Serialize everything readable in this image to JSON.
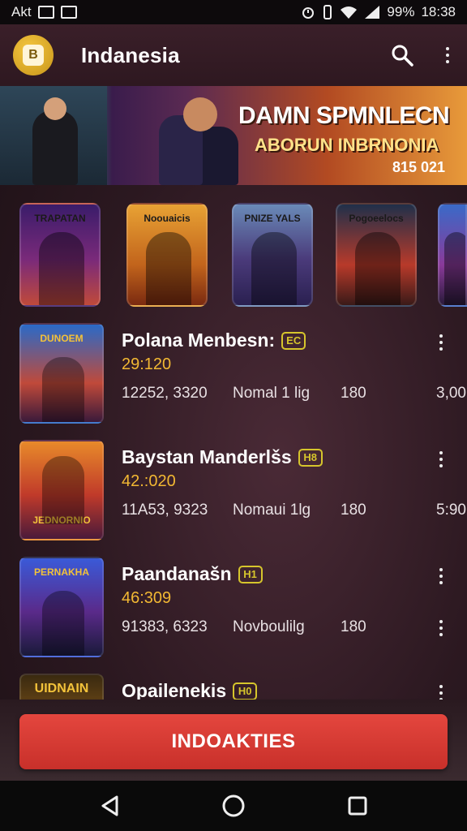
{
  "status_bar": {
    "carrier": "Akt",
    "battery": "99%",
    "time": "18:38"
  },
  "app_bar": {
    "logo_letter": "B",
    "title": "Indanesia",
    "search_icon": "search-icon",
    "menu_icon": "more-vert-icon"
  },
  "banner": {
    "headline": "DAMN SPMNLECN",
    "subheadline": "ABORUN INBRNONIA",
    "code": "815 021"
  },
  "featured_tiles": [
    {
      "label": "TRAPATAN",
      "bg": "linear-gradient(180deg,#3a1c6a,#7a2a7a 55%,#c04a3a)"
    },
    {
      "label": "Noouaicis",
      "bg": "linear-gradient(180deg,#e8a234,#c2641c 60%,#7a2a10)"
    },
    {
      "label": "PNIZE YALS",
      "bg": "linear-gradient(180deg,#6a8ab8,#4a3a7a 55%,#2a2050)"
    },
    {
      "label": "Pogoeelocs",
      "bg": "linear-gradient(180deg,#20304a,#b83a2a 60%,#3a1a18)"
    },
    {
      "label": "",
      "bg": "linear-gradient(180deg,#3a6ac8,#8a3a9a 60%,#2a1a3a)"
    }
  ],
  "list": [
    {
      "title": "Polana Menbesn:",
      "badge": "EC",
      "score": "29:120",
      "stat_a": "12252, 3320",
      "stat_b": "Nomal 1 lig",
      "stat_c": "180",
      "stat_d": "3,00",
      "thumb_label": "DUNOEM",
      "thumb_bg": "linear-gradient(180deg,#2a6ac8,#c04a3a 60%,#3a1a3a)",
      "show_stats_kebab": false
    },
    {
      "title": "Baystan Manderlšs",
      "badge": "H8",
      "score": "42.:020",
      "stat_a": "11A53, 9323",
      "stat_b": "Nomaui 1lg",
      "stat_c": "180",
      "stat_d": "5:90",
      "thumb_label": "JEDNORNIO",
      "thumb_bg": "linear-gradient(180deg,#e88a2a,#c03a2a 55%,#4a1a3a)",
      "show_stats_kebab": false
    },
    {
      "title": "Paandanašn",
      "badge": "H1",
      "score": "46:309",
      "stat_a": "91383, 6323",
      "stat_b": "Novboulilg",
      "stat_c": "180",
      "stat_d": "",
      "thumb_label": "PERNAKHA",
      "thumb_bg": "linear-gradient(180deg,#3a5ad8,#5a2a8a 55%,#1a1a3a)",
      "show_stats_kebab": true
    },
    {
      "title": "Opailenekis",
      "badge": "H0",
      "score": "",
      "stat_a": "",
      "stat_b": "",
      "stat_c": "",
      "stat_d": "",
      "thumb_label": "UIDNAIN",
      "thumb_bg": "linear-gradient(180deg,#3a2a10,#8a5a1a 60%,#2a1a10)",
      "show_stats_kebab": false
    }
  ],
  "cta": {
    "label": "INDOAKTIES"
  },
  "nav_bar": {
    "back_icon": "back-triangle-icon",
    "home_icon": "home-circle-icon",
    "recents_icon": "recents-square-icon"
  }
}
